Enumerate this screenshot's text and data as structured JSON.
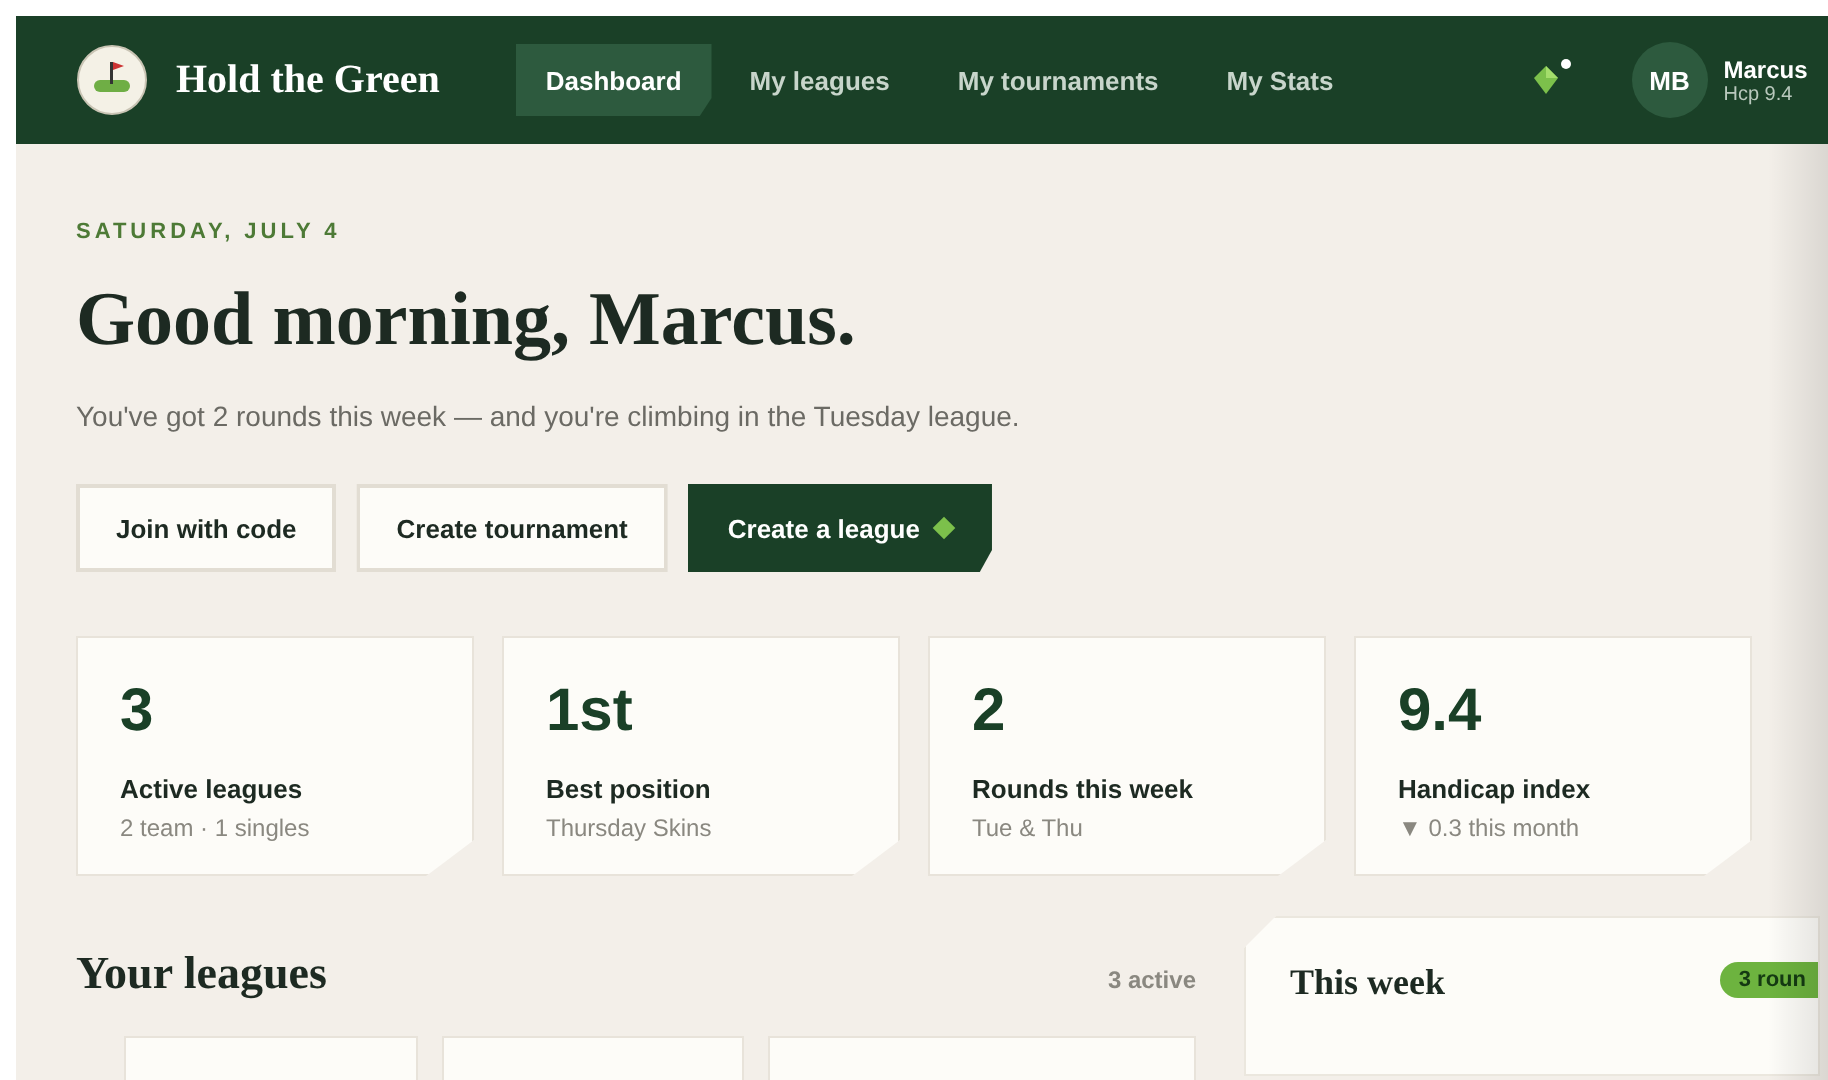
{
  "brand": {
    "name": "Hold the Green"
  },
  "nav": [
    {
      "label": "Dashboard",
      "selected": true
    },
    {
      "label": "My leagues",
      "selected": false
    },
    {
      "label": "My tournaments",
      "selected": false
    },
    {
      "label": "My Stats",
      "selected": false
    }
  ],
  "notifications": {
    "unread": true
  },
  "user": {
    "initials": "MB",
    "name": "Marcus",
    "handicap": "Hcp 9.4"
  },
  "date": "SATURDAY, JULY 4",
  "greeting": "Good morning, Marcus.",
  "summary": "You've got 2 rounds this week — and you're climbing in the Tuesday league.",
  "actions": [
    {
      "label": "Join with code",
      "kind": "outline"
    },
    {
      "label": "Create tournament",
      "kind": "outline"
    },
    {
      "label": "Create a league",
      "kind": "primary"
    }
  ],
  "stats": [
    {
      "value": "3",
      "label": "Active leagues",
      "detail": "2 team · 1 singles"
    },
    {
      "value": "1st",
      "label": "Best position",
      "detail": "Thursday Skins"
    },
    {
      "value": "2",
      "label": "Rounds this week",
      "detail": "Tue & Thu"
    },
    {
      "value": "9.4",
      "label": "Handicap index",
      "detail": "▼ 0.3 this month"
    }
  ],
  "leagues_section": {
    "title": "Your leagues",
    "count": "3 active"
  },
  "week_panel": {
    "title": "This week",
    "badge": "3 roun"
  }
}
